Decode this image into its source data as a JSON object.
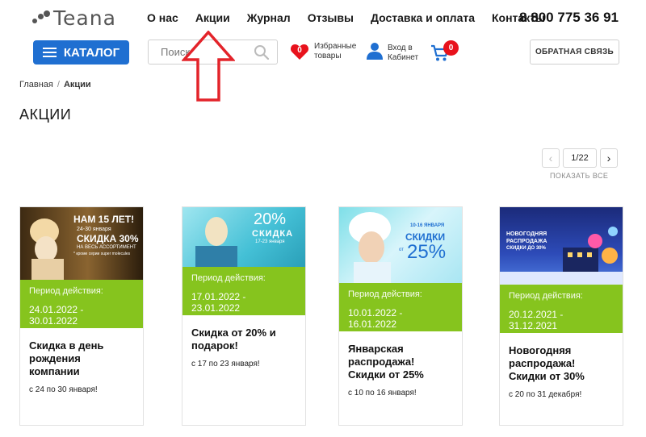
{
  "header": {
    "logo_text": "Teana",
    "nav": [
      "О нас",
      "Акции",
      "Журнал",
      "Отзывы",
      "Доставка и оплата",
      "Контакты"
    ],
    "phone": "8 800 775 36 91",
    "catalog_label": "КАТАЛОГ",
    "search_placeholder": "Поиск",
    "favorites_label_1": "Избранные",
    "favorites_label_2": "товары",
    "favorites_count": "0",
    "login_label_1": "Вход в",
    "login_label_2": "Кабинет",
    "cart_count": "0",
    "feedback_label": "ОБРАТНАЯ СВЯЗЬ"
  },
  "breadcrumbs": {
    "home": "Главная",
    "current": "Акции"
  },
  "page_title": "АКЦИИ",
  "pager": {
    "current": "1/22",
    "show_all": "ПОКАЗАТЬ ВСЕ"
  },
  "colors": {
    "accent_blue": "#1f6fd1",
    "period_green": "#86c41e",
    "badge_red": "#e8121c",
    "arrow_red": "#e3232a"
  },
  "cards": [
    {
      "banner_lines": [
        "НАМ 15 ЛЕТ!",
        "24-30 января",
        "СКИДКА 30%",
        "НА ВЕСЬ АССОРТИМЕНТ",
        "* кроме серии super molecules"
      ],
      "period_label": "Период действия:",
      "period_dates": "24.01.2022 - 30.01.2022",
      "title": "Скидка в день рождения компании",
      "desc": "с 24 по 30 января!"
    },
    {
      "banner_lines": [
        "20%",
        "СКИДКА",
        "17-23 января"
      ],
      "period_label": "Период действия:",
      "period_dates": "17.01.2022 - 23.01.2022",
      "title": "Скидка от 20% и подарок!",
      "desc": "с 17 по 23 января!"
    },
    {
      "banner_lines": [
        "10-16 ЯНВАРЯ",
        "СКИДКИ",
        "от",
        "25%"
      ],
      "period_label": "Период действия:",
      "period_dates": "10.01.2022 - 16.01.2022",
      "title": "Январская распродажа! Скидки от 25%",
      "desc": "с 10 по 16 января!"
    },
    {
      "banner_lines": [
        "НОВОГОДНЯЯ",
        "РАСПРОДАЖА",
        "СКИДКИ ДО 30%"
      ],
      "period_label": "Период действия:",
      "period_dates": "20.12.2021 - 31.12.2021",
      "title": "Новогодняя распродажа! Скидки от 30%",
      "desc": "с 20 по 31 декабря!"
    }
  ]
}
